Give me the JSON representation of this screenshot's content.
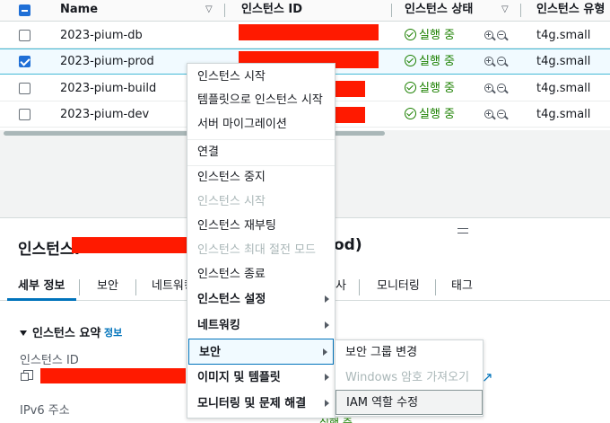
{
  "table": {
    "headers": {
      "name": "Name",
      "instance_id": "인스턴스 ID",
      "state": "인스턴스 상태",
      "type": "인스턴스 유형"
    },
    "rows": [
      {
        "name": "2023-pium-db",
        "state": "실행 중",
        "type": "t4g.small",
        "selected": false
      },
      {
        "name": "2023-pium-prod",
        "state": "실행 중",
        "type": "t4g.small",
        "selected": true
      },
      {
        "name": "2023-pium-build",
        "state": "실행 중",
        "type": "t4g.small",
        "selected": false
      },
      {
        "name": "2023-pium-dev",
        "state": "실행 중",
        "type": "t4g.small",
        "selected": false
      }
    ]
  },
  "details": {
    "title_prefix": "인스턴스:",
    "title_suffix": "od)",
    "tabs": [
      "세부 정보",
      "보안",
      "네트워킹",
      "사",
      "모니터링",
      "태그"
    ],
    "active_tab": "세부 정보",
    "summary_header": "인스턴스 요약",
    "info_link": "정보",
    "instance_id_label": "인스턴스 ID",
    "ipv6_label": "IPv6 주소",
    "partial_status": "실행 중"
  },
  "context_menu": {
    "items": [
      {
        "label": "인스턴스 시작",
        "disabled": false,
        "bold": false,
        "submenu": false
      },
      {
        "label": "템플릿으로 인스턴스 시작",
        "disabled": false,
        "bold": false,
        "submenu": false
      },
      {
        "label": "서버 마이그레이션",
        "disabled": false,
        "bold": false,
        "submenu": false
      },
      {
        "label": "연결",
        "disabled": false,
        "bold": false,
        "submenu": false
      },
      {
        "label": "인스턴스 중지",
        "disabled": false,
        "bold": false,
        "submenu": false
      },
      {
        "label": "인스턴스 시작",
        "disabled": true,
        "bold": false,
        "submenu": false
      },
      {
        "label": "인스턴스 재부팅",
        "disabled": false,
        "bold": false,
        "submenu": false
      },
      {
        "label": "인스턴스 최대 절전 모드",
        "disabled": true,
        "bold": false,
        "submenu": false
      },
      {
        "label": "인스턴스 종료",
        "disabled": false,
        "bold": false,
        "submenu": false
      },
      {
        "label": "인스턴스 설정",
        "disabled": false,
        "bold": true,
        "submenu": true
      },
      {
        "label": "네트워킹",
        "disabled": false,
        "bold": true,
        "submenu": true
      },
      {
        "label": "보안",
        "disabled": false,
        "bold": true,
        "submenu": true,
        "active": true
      },
      {
        "label": "이미지 및 템플릿",
        "disabled": false,
        "bold": true,
        "submenu": true
      },
      {
        "label": "모니터링 및 문제 해결",
        "disabled": false,
        "bold": true,
        "submenu": true
      }
    ]
  },
  "security_submenu": {
    "items": [
      {
        "label": "보안 그룹 변경",
        "disabled": false
      },
      {
        "label": "Windows 암호 가져오기",
        "disabled": true
      },
      {
        "label": "IAM 역할 수정",
        "disabled": false,
        "hover": true
      }
    ]
  },
  "colors": {
    "accent": "#0073bb",
    "running": "#1d8102",
    "redaction": "#ff1a00"
  }
}
